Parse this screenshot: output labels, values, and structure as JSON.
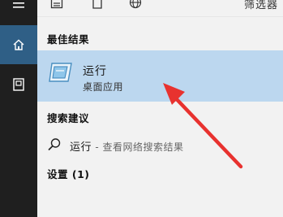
{
  "rail": {
    "menu_icon": "hamburger-menu-icon",
    "home_icon": "home-icon",
    "doc_icon": "document-icon"
  },
  "topbar": {
    "icons": [
      "apps-icon",
      "document-icon",
      "globe-icon"
    ],
    "filter_label": "筛选器"
  },
  "best_match": {
    "heading": "最佳结果",
    "title": "运行",
    "subtitle": "桌面应用"
  },
  "suggestions": {
    "heading": "搜索建议",
    "query": "运行",
    "hint": " - 查看网络搜索结果"
  },
  "settings": {
    "heading": "设置 (1)"
  },
  "colors": {
    "rail_bg": "#1f1f1f",
    "rail_active": "#2f5f86",
    "highlight": "#bcd7ef",
    "arrow": "#e8322f"
  }
}
